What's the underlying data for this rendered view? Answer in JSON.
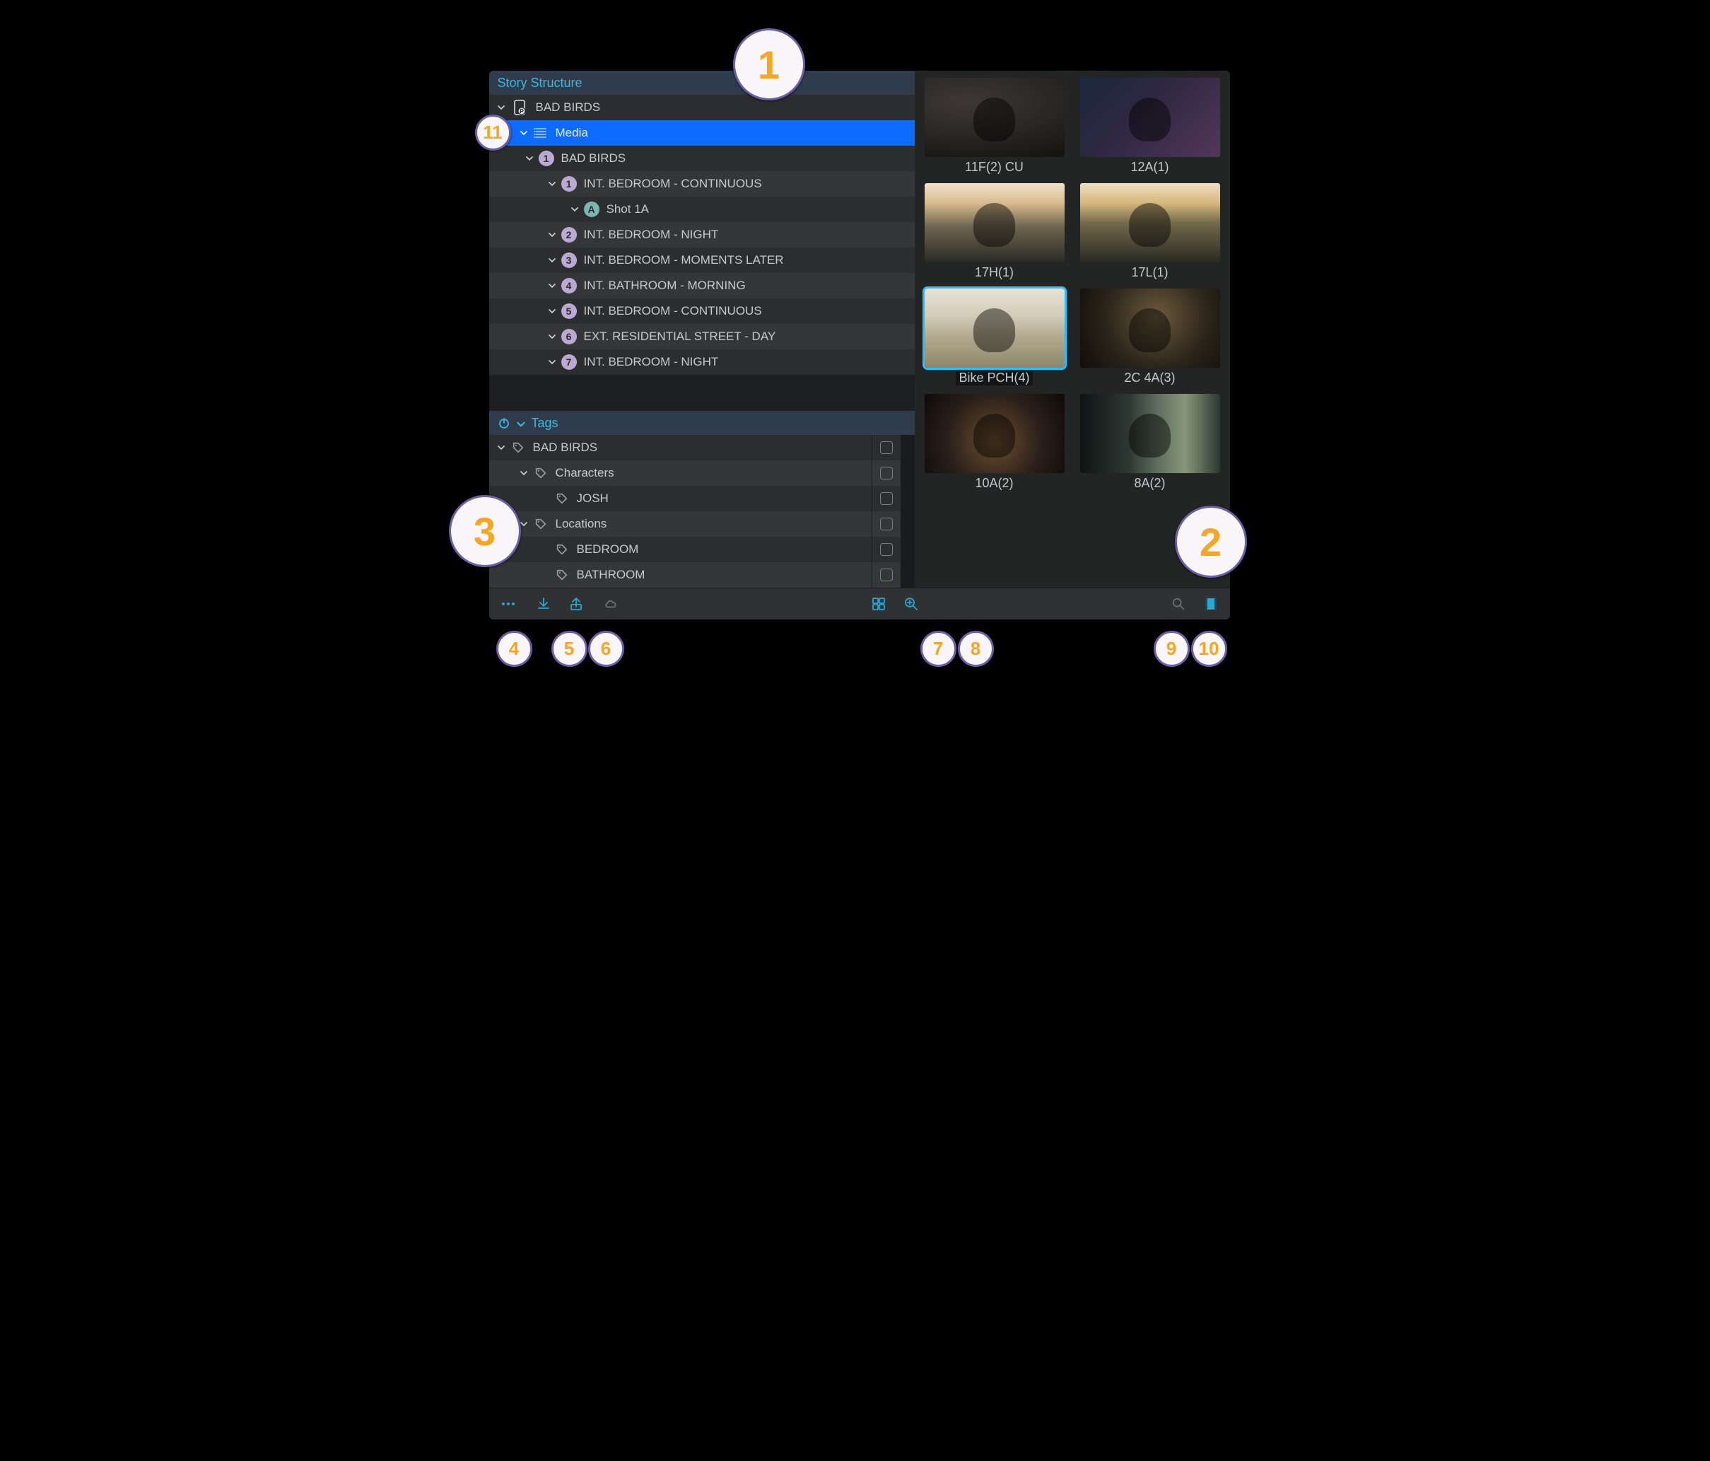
{
  "structure": {
    "header_label": "Story Structure",
    "root_label": "BAD BIRDS",
    "media_label": "Media",
    "project_label": "BAD BIRDS",
    "project_badge": "1",
    "scenes": [
      {
        "badge": "1",
        "label": "INT. BEDROOM - CONTINUOUS"
      },
      {
        "badge": "2",
        "label": "INT. BEDROOM - NIGHT"
      },
      {
        "badge": "3",
        "label": "INT. BEDROOM - MOMENTS LATER"
      },
      {
        "badge": "4",
        "label": "INT. BATHROOM - MORNING"
      },
      {
        "badge": "5",
        "label": "INT. BEDROOM - CONTINUOUS"
      },
      {
        "badge": "6",
        "label": "EXT. RESIDENTIAL STREET - DAY"
      },
      {
        "badge": "7",
        "label": "INT. BEDROOM - NIGHT"
      }
    ],
    "shot_badge": "A",
    "shot_label": "Shot 1A"
  },
  "tags": {
    "header_label": "Tags",
    "root_label": "BAD BIRDS",
    "groups": [
      {
        "label": "Characters",
        "items": [
          "JOSH"
        ]
      },
      {
        "label": "Locations",
        "items": [
          "BEDROOM",
          "BATHROOM"
        ]
      }
    ]
  },
  "thumbnails": [
    {
      "name": "11F(2) CU",
      "ph": "ph-sand",
      "selected": false
    },
    {
      "name": "12A(1)",
      "ph": "ph-blue",
      "selected": false
    },
    {
      "name": "17H(1)",
      "ph": "ph-sunset",
      "selected": false
    },
    {
      "name": "17L(1)",
      "ph": "ph-sunset2",
      "selected": false
    },
    {
      "name": "Bike PCH(4)",
      "ph": "ph-desert",
      "selected": true
    },
    {
      "name": "2C 4A(3)",
      "ph": "ph-room",
      "selected": false
    },
    {
      "name": "10A(2)",
      "ph": "ph-room2",
      "selected": false
    },
    {
      "name": "8A(2)",
      "ph": "ph-hall",
      "selected": false
    }
  ],
  "markers": {
    "m1": "1",
    "m2": "2",
    "m3": "3",
    "m4": "4",
    "m5": "5",
    "m6": "6",
    "m7": "7",
    "m8": "8",
    "m9": "9",
    "m10": "10",
    "m11": "11"
  }
}
